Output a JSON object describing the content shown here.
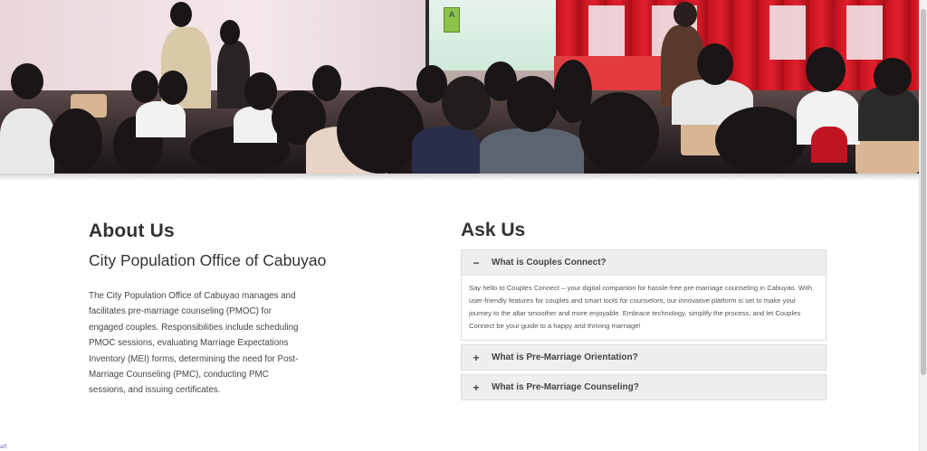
{
  "about": {
    "heading": "About Us",
    "subheading": "City Population Office of Cabuyao",
    "body": "The City Population Office of Cabuyao manages and facilitates pre-marriage counseling (PMOC) for engaged couples. Responsibilities include scheduling PMOC sessions, evaluating Marriage Expectations Inventory (MEI) forms, determining the need for Post-Marriage Counseling (PMC), conducting PMC sessions, and issuing certificates."
  },
  "ask": {
    "heading": "Ask Us",
    "items": [
      {
        "sign": "−",
        "question": "What is Couples Connect?",
        "answer": "Say hello to Couples Connect – your digital companion for hassle-free pre-marriage counseling in Cabuyao. With user-friendly features for couples and smart tools for counselors, our innovative platform is set to make your journey to the altar smoother and more enjoyable. Embrace technology, simplify the process, and let Couples Connect be your guide to a happy and thriving marriage!"
      },
      {
        "sign": "+",
        "question": "What is Pre-Marriage Orientation?"
      },
      {
        "sign": "+",
        "question": "What is Pre-Marriage Counseling?"
      }
    ]
  },
  "hero": {
    "screen_letter": "A"
  },
  "status": {
    "text": "alt"
  },
  "colors": {
    "faq_header_bg": "#eeeeee",
    "heading": "#333333",
    "curtain": "#d21a25"
  }
}
